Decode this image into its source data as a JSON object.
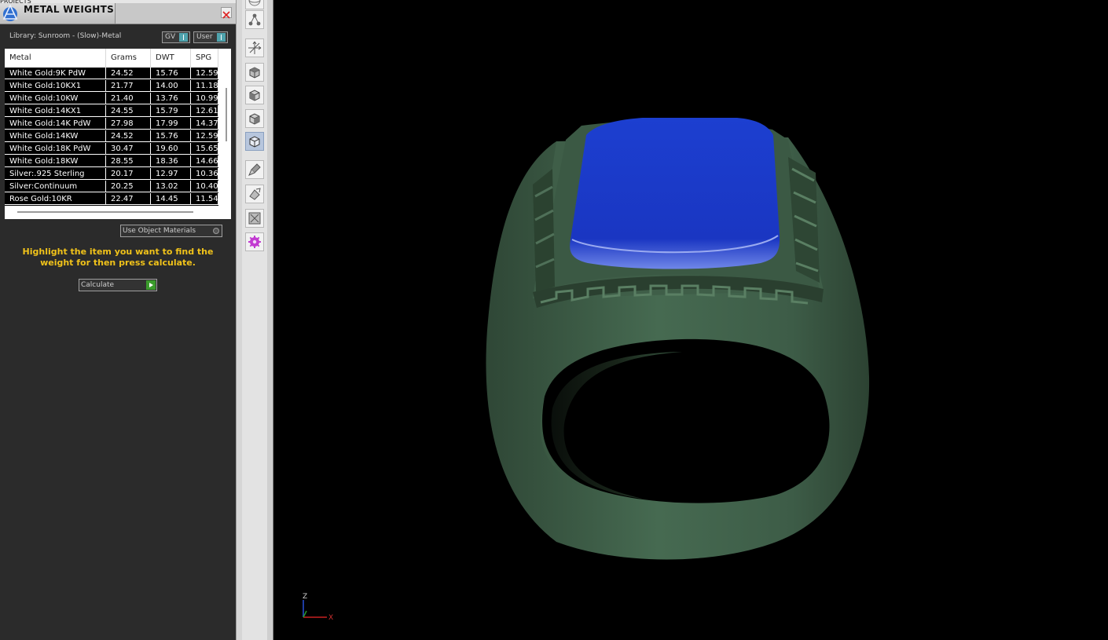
{
  "panel": {
    "projects_label": "PROJECTS",
    "title": "METAL WEIGHTS",
    "library_label": "Library: Sunroom - (Slow)-Metal",
    "toggle_gv": "GV",
    "toggle_user": "User",
    "use_object_materials": "Use Object Materials",
    "instructions": "Highlight the item you want to find the weight for then press calculate.",
    "calculate_label": "Calculate",
    "accent_color": "#f0c21a"
  },
  "table": {
    "columns": [
      "Metal",
      "Grams",
      "DWT",
      "SPG"
    ],
    "rows": [
      [
        "White Gold:9K PdW",
        "24.52",
        "15.76",
        "12.59"
      ],
      [
        "White Gold:10KX1",
        "21.77",
        "14.00",
        "11.18"
      ],
      [
        "White Gold:10KW",
        "21.40",
        "13.76",
        "10.99"
      ],
      [
        "White Gold:14KX1",
        "24.55",
        "15.79",
        "12.61"
      ],
      [
        "White Gold:14K PdW",
        "27.98",
        "17.99",
        "14.37"
      ],
      [
        "White Gold:14KW",
        "24.52",
        "15.76",
        "12.59"
      ],
      [
        "White Gold:18K PdW",
        "30.47",
        "19.60",
        "15.65"
      ],
      [
        "White Gold:18KW",
        "28.55",
        "18.36",
        "14.66"
      ],
      [
        "Silver:.925 Sterling",
        "20.17",
        "12.97",
        "10.36"
      ],
      [
        "Silver:Continuum",
        "20.25",
        "13.02",
        "10.40"
      ],
      [
        "Rose Gold:10KR",
        "22.47",
        "14.45",
        "11.54"
      ]
    ]
  },
  "toolbar": {
    "icons": [
      "sphere-icon",
      "nodes-icon",
      "axes-icon",
      "cube-top-icon",
      "cube-front-icon",
      "cube-side-icon",
      "cube-iso-icon",
      "brush-icon",
      "paint-icon",
      "zoom-fit-icon",
      "gear-purple-icon"
    ]
  },
  "viewport": {
    "axis_z": "Z",
    "axis_x": "X",
    "gem_color": "#1e40c8",
    "metal_color": "#3d5a45"
  }
}
